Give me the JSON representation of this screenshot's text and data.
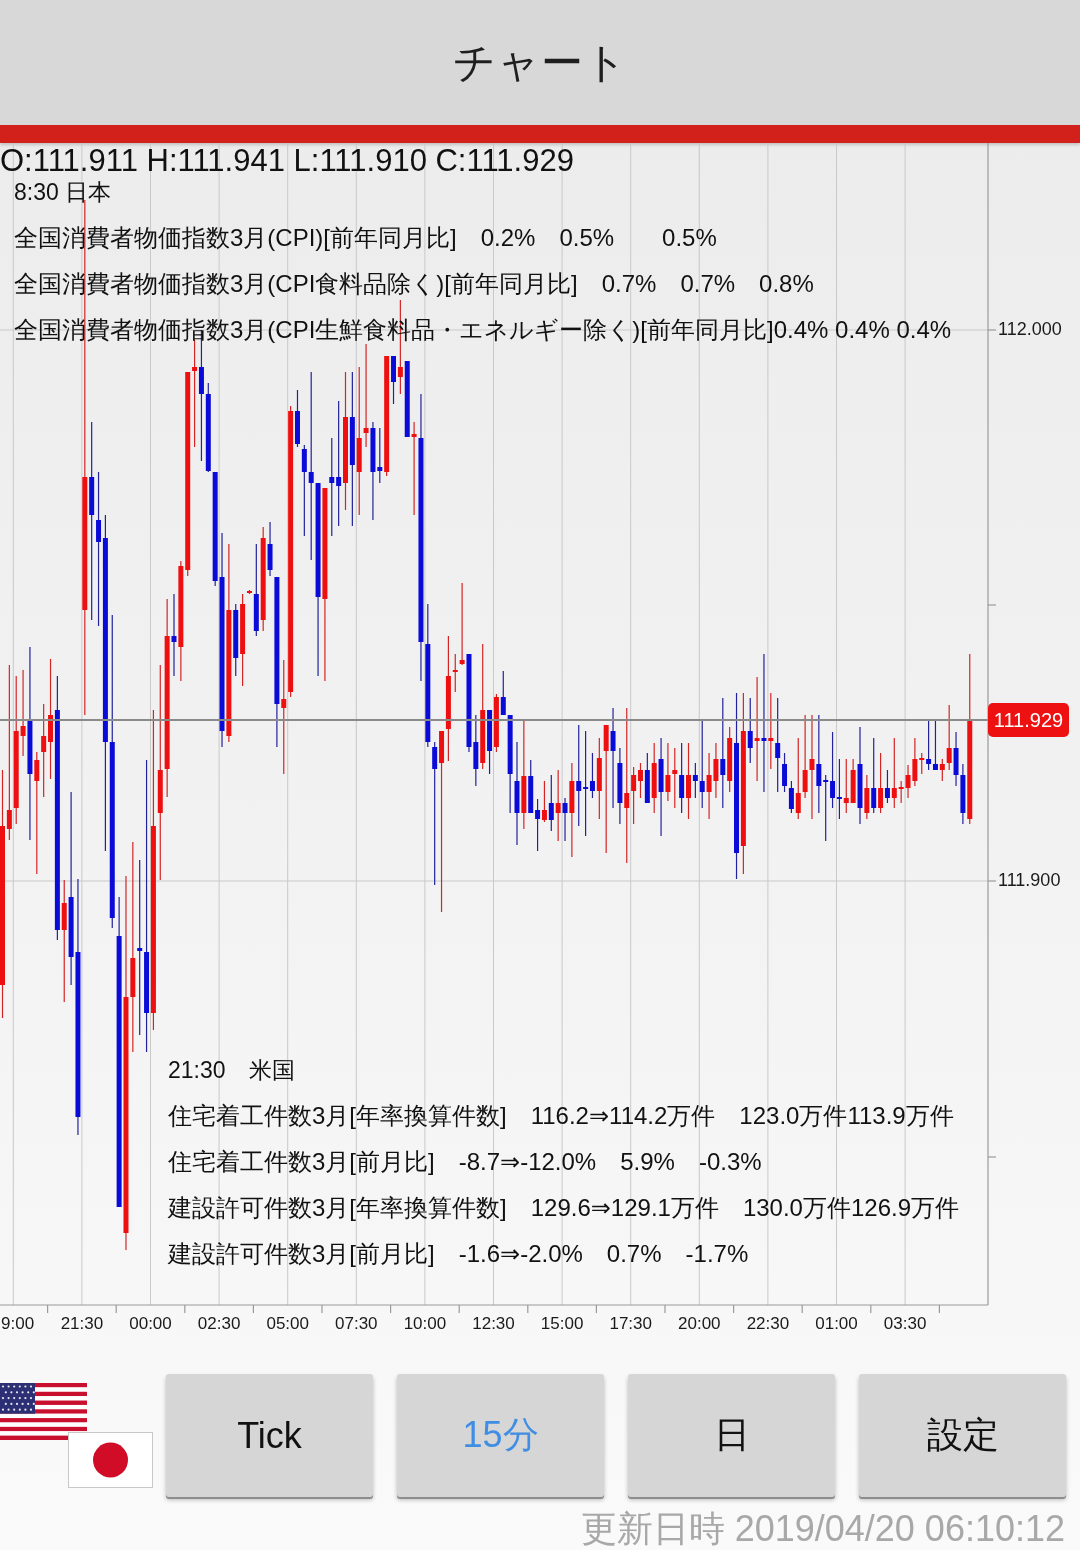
{
  "header": {
    "title": "チャート"
  },
  "quote": {
    "ohlc": "O:111.911 H:111.941 L:111.910 C:111.929"
  },
  "chart": {
    "events": [
      {
        "heading": "8:30 日本",
        "lines": [
          "全国消費者物価指数3月(CPI)[前年同月比]　0.2%　0.5%　　0.5%",
          "全国消費者物価指数3月(CPI食料品除く)[前年同月比]　0.7%　0.7%　0.8%",
          "全国消費者物価指数3月(CPI生鮮食料品・エネルギー除く)[前年同月比]0.4% 0.4% 0.4%"
        ]
      },
      {
        "heading": "21:30　米国",
        "lines": [
          "住宅着工件数3月[年率換算件数]　116.2⇒114.2万件　123.0万件113.9万件",
          "住宅着工件数3月[前月比]　-8.7⇒-12.0%　5.9%　-0.3%",
          "建設許可件数3月[年率換算件数]　129.6⇒129.1万件　130.0万件126.9万件",
          "建設許可件数3月[前月比]　-1.6⇒-2.0%　0.7%　-1.7%"
        ]
      }
    ],
    "price_labels": [
      "112.000",
      "111.900"
    ],
    "current_price": "111.929",
    "time_labels": [
      "9:00",
      "21:30",
      "00:00",
      "02:30",
      "05:00",
      "07:30",
      "10:00",
      "12:30",
      "15:00",
      "17:30",
      "20:00",
      "22:30",
      "01:00",
      "03:30"
    ]
  },
  "buttons": [
    {
      "label": "Tick",
      "selected": false
    },
    {
      "label": "15分",
      "selected": true
    },
    {
      "label": "日",
      "selected": false
    },
    {
      "label": "設定",
      "selected": false
    }
  ],
  "updated": "更新日時 2019/04/20 06:10:12"
}
